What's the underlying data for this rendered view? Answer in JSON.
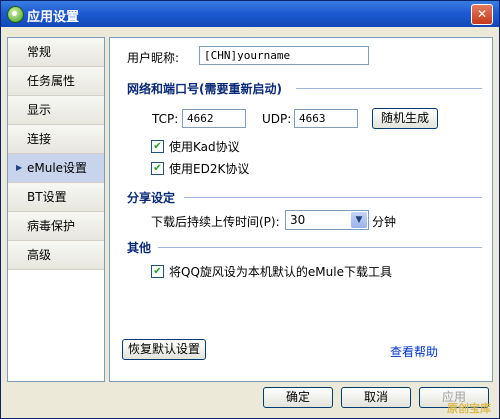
{
  "window": {
    "title": "应用设置",
    "close_glyph": "✕"
  },
  "sidebar": {
    "items": [
      {
        "label": "常规"
      },
      {
        "label": "任务属性"
      },
      {
        "label": "显示"
      },
      {
        "label": "连接"
      },
      {
        "label": "eMule设置",
        "active": true,
        "arrow": "▶"
      },
      {
        "label": "BT设置"
      },
      {
        "label": "病毒保护"
      },
      {
        "label": "高级"
      }
    ]
  },
  "panel": {
    "nickname": {
      "label": "用户昵称:",
      "value": "[CHN]yourname"
    },
    "network": {
      "title": "网络和端口号(需要重新启动)",
      "tcp_label": "TCP:",
      "tcp_value": "4662",
      "udp_label": "UDP:",
      "udp_value": "4663",
      "random_button": "随机生成",
      "kad": {
        "label": "使用Kad协议",
        "checked": true
      },
      "ed2k": {
        "label": "使用ED2K协议",
        "checked": true
      },
      "check_glyph": "✔"
    },
    "share": {
      "title": "分享设定",
      "upload_label": "下载后持续上传时间(P):",
      "upload_value": "30",
      "unit": "分钟",
      "arrow_glyph": "▼"
    },
    "other": {
      "title": "其他",
      "default_label": "将QQ旋风设为本机默认的eMule下载工具",
      "checked": true
    },
    "restore_button": "恢复默认设置",
    "help_link": "查看帮助"
  },
  "footer": {
    "ok": "确定",
    "cancel": "取消",
    "apply": "应用"
  },
  "watermark": "原创宝库"
}
